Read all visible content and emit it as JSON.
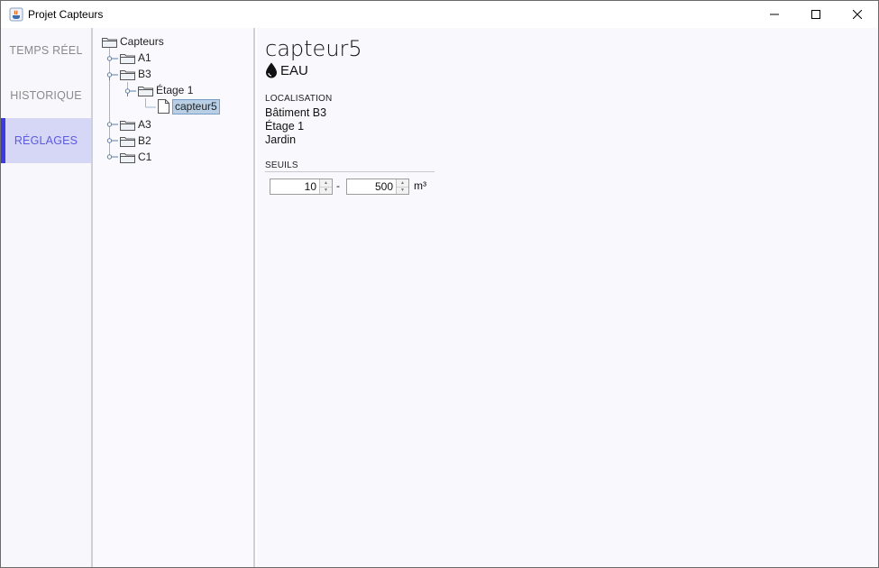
{
  "window": {
    "title": "Projet Capteurs"
  },
  "sidebar": {
    "items": [
      {
        "label": "TEMPS RÉEL",
        "active": false
      },
      {
        "label": "HISTORIQUE",
        "active": false
      },
      {
        "label": "RÉGLAGES",
        "active": true
      }
    ]
  },
  "tree": {
    "root": "Capteurs",
    "nodes": [
      "A1",
      "B3",
      "Étage 1",
      "capteur5",
      "A3",
      "B2",
      "C1"
    ],
    "selected": "capteur5"
  },
  "detail": {
    "name": "capteur5",
    "type": "EAU",
    "localisation_label": "LOCALISATION",
    "localisation": [
      "Bâtiment B3",
      "Étage 1",
      "Jardin"
    ],
    "seuils_label": "SEUILS",
    "seuil_min": "10",
    "separator": "-",
    "seuil_max": "500",
    "unit": "m³"
  },
  "colors": {
    "accent": "#3b3be0",
    "active_bg": "#d6d6f7",
    "selection": "#b8cfe5"
  }
}
